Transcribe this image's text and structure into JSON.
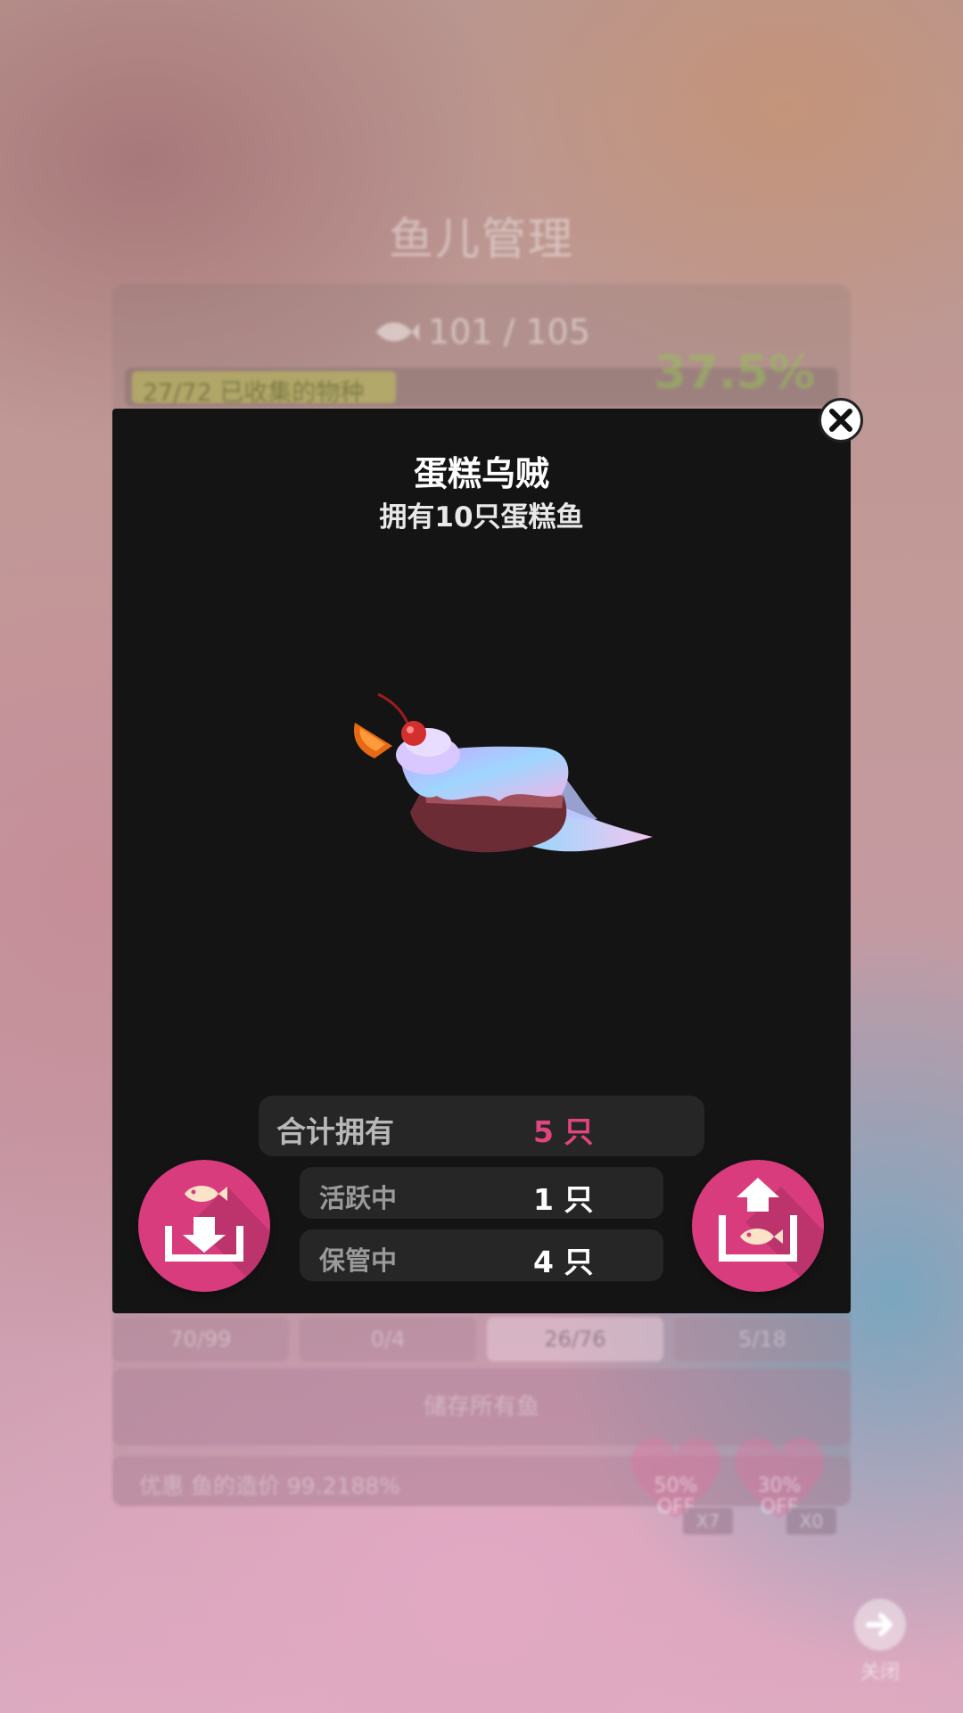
{
  "background": {
    "title": "鱼儿管理",
    "fish_count": "101 / 105",
    "species_progress": "27/72 已收集的物种",
    "species_percent": "37.5%",
    "tabs": [
      "70/99",
      "0/4",
      "26/76",
      "5/18"
    ],
    "store_all_label": "储存所有鱼",
    "discount_text": "优惠 鱼的造价 99.2188%",
    "coupons": [
      {
        "label": "50%",
        "off": "OFF",
        "multiplier": "X7"
      },
      {
        "label": "30%",
        "off": "OFF",
        "multiplier": "X0"
      }
    ],
    "close_label": "关闭"
  },
  "modal": {
    "title": "蛋糕乌贼",
    "subtitle": "拥有10只蛋糕鱼",
    "total_label": "合计拥有",
    "total_value": "5 只",
    "active_label": "活跃中",
    "active_value": "1 只",
    "stored_label": "保管中",
    "stored_value": "4 只"
  },
  "colors": {
    "accent_pink": "#d83c7d",
    "total_value_color": "#e0457f",
    "modal_bg": "#141414"
  },
  "icons": {
    "close": "close-icon",
    "store_fish": "store-fish-icon",
    "release_fish": "release-fish-icon",
    "fish": "fish-icon"
  }
}
